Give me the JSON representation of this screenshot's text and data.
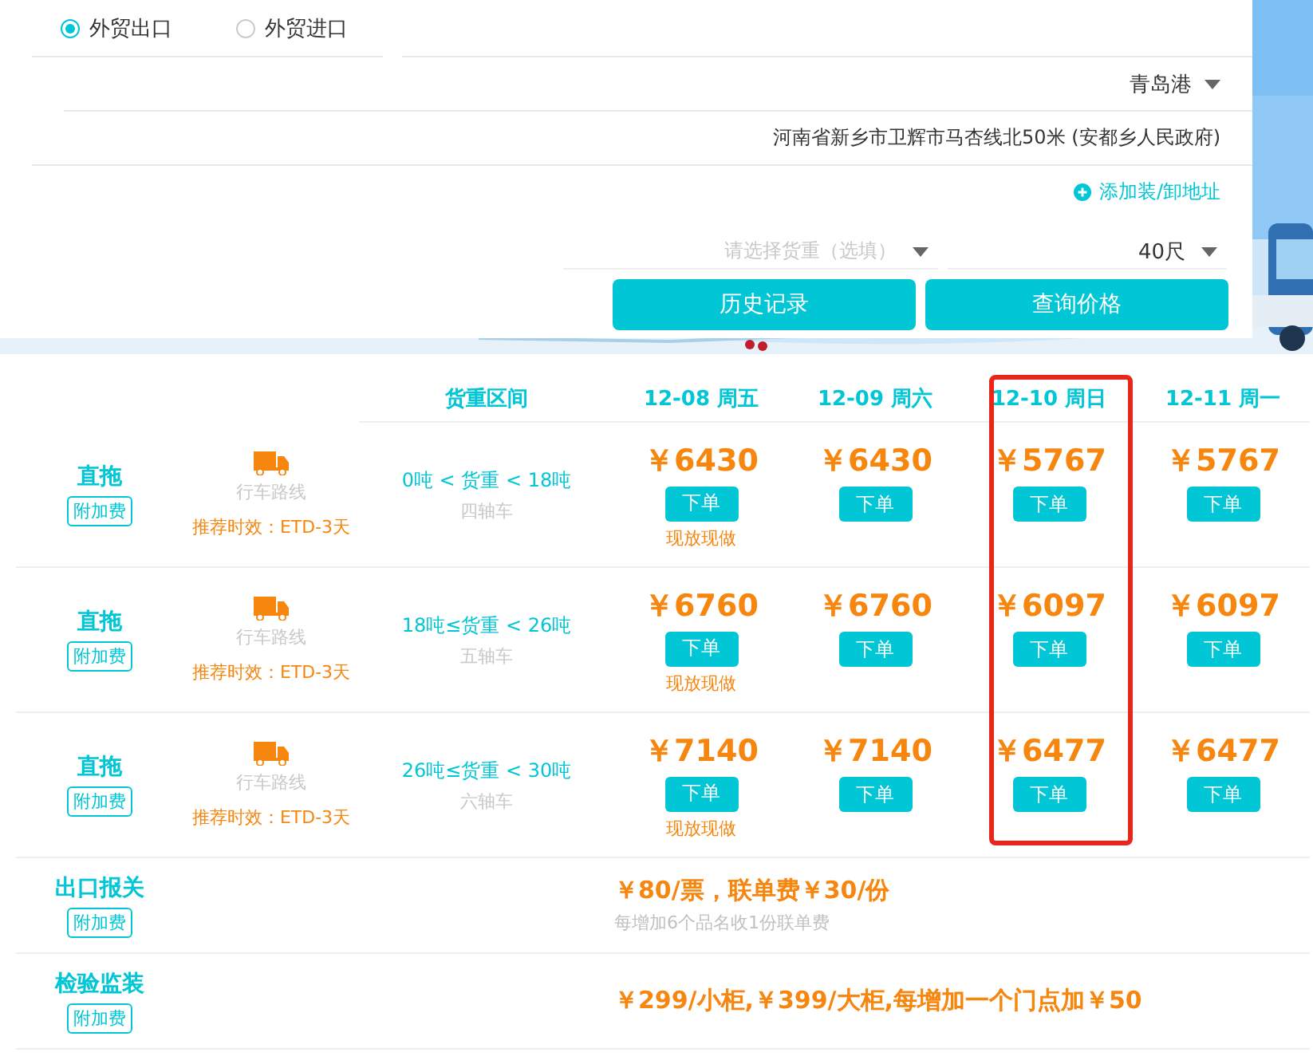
{
  "trade_type": [
    {
      "label": "外贸出口",
      "selected": true
    },
    {
      "label": "外贸进口",
      "selected": false
    }
  ],
  "port": {
    "value": "青岛港"
  },
  "address": {
    "value": "河南省新乡市卫辉市马杏线北50米 (安都乡人民政府)"
  },
  "add_address_link": "添加装/卸地址",
  "weight_select": {
    "placeholder": "请选择货重（选填）"
  },
  "container_select": {
    "value": "40尺"
  },
  "buttons": [
    "历史记录",
    "查询价格"
  ],
  "table": {
    "weight_header": "货重区间",
    "dates": [
      {
        "label": "12-08 周五",
        "highlighted": false
      },
      {
        "label": "12-09 周六",
        "highlighted": false
      },
      {
        "label": "12-10 周日",
        "highlighted": true
      },
      {
        "label": "12-11 周一",
        "highlighted": false
      }
    ],
    "rows": [
      {
        "type": "直拖",
        "tag": "附加费",
        "route": "行车路线",
        "timing": "推荐时效：ETD-3天",
        "weight": "0吨 < 货重 < 18吨",
        "axle": "四轴车",
        "prices": [
          {
            "price": "￥6430",
            "button": "下单",
            "note": "现放现做"
          },
          {
            "price": "￥6430",
            "button": "下单"
          },
          {
            "price": "￥5767",
            "button": "下单"
          },
          {
            "price": "￥5767",
            "button": "下单"
          }
        ]
      },
      {
        "type": "直拖",
        "tag": "附加费",
        "route": "行车路线",
        "timing": "推荐时效：ETD-3天",
        "weight": "18吨≤货重 < 26吨",
        "axle": "五轴车",
        "prices": [
          {
            "price": "￥6760",
            "button": "下单",
            "note": "现放现做"
          },
          {
            "price": "￥6760",
            "button": "下单"
          },
          {
            "price": "￥6097",
            "button": "下单"
          },
          {
            "price": "￥6097",
            "button": "下单"
          }
        ]
      },
      {
        "type": "直拖",
        "tag": "附加费",
        "route": "行车路线",
        "timing": "推荐时效：ETD-3天",
        "weight": "26吨≤货重 < 30吨",
        "axle": "六轴车",
        "prices": [
          {
            "price": "￥7140",
            "button": "下单",
            "note": "现放现做"
          },
          {
            "price": "￥7140",
            "button": "下单"
          },
          {
            "price": "￥6477",
            "button": "下单"
          },
          {
            "price": "￥6477",
            "button": "下单"
          }
        ]
      }
    ],
    "fees": [
      {
        "name": "出口报关",
        "tag": "附加费",
        "price": "￥80/票，联单费￥30/份",
        "note": "每增加6个品名收1份联单费"
      },
      {
        "name": "检验监装",
        "tag": "附加费",
        "price": "￥299/小柜,￥399/大柜,每增加一个门点加￥50"
      }
    ]
  }
}
